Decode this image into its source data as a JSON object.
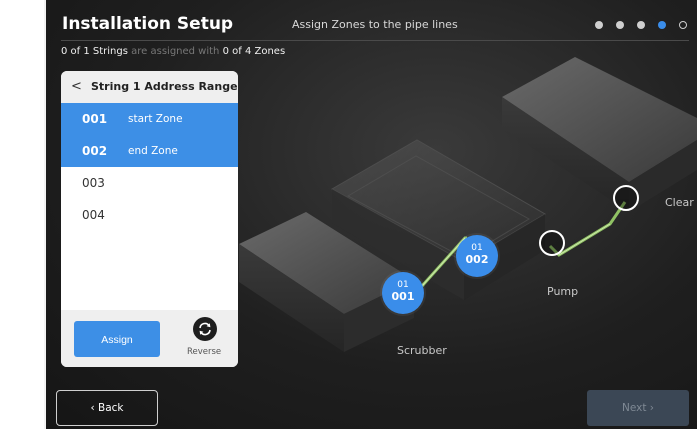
{
  "header": {
    "title": "Installation Setup",
    "subtitle": "Assign Zones to the pipe lines",
    "steps": {
      "total": 5,
      "current": 4
    }
  },
  "summary": {
    "strings_assigned": "0 of 1 Strings",
    "middle": "are assigned with",
    "zones": "0 of 4 Zones"
  },
  "panel": {
    "back_glyph": "<",
    "title": "String 1 Address Range",
    "zones": [
      {
        "num": "001",
        "label": "start Zone",
        "selected": true
      },
      {
        "num": "002",
        "label": "end Zone",
        "selected": true
      },
      {
        "num": "003",
        "label": "",
        "selected": false
      },
      {
        "num": "004",
        "label": "",
        "selected": false
      }
    ],
    "assign_label": "Assign",
    "reverse_label": "Reverse"
  },
  "diagram": {
    "tanks": [
      "Scrubber",
      "Pump",
      "Clear"
    ],
    "badges": [
      {
        "string": "01",
        "zone": "001"
      },
      {
        "string": "01",
        "zone": "002"
      }
    ],
    "pipe_color": "#9bd36a"
  },
  "footer": {
    "back_label": "Back",
    "next_label": "Next"
  },
  "colors": {
    "accent": "#3a8dea",
    "panel": "#ffffff",
    "background": "#1f1f1f"
  }
}
